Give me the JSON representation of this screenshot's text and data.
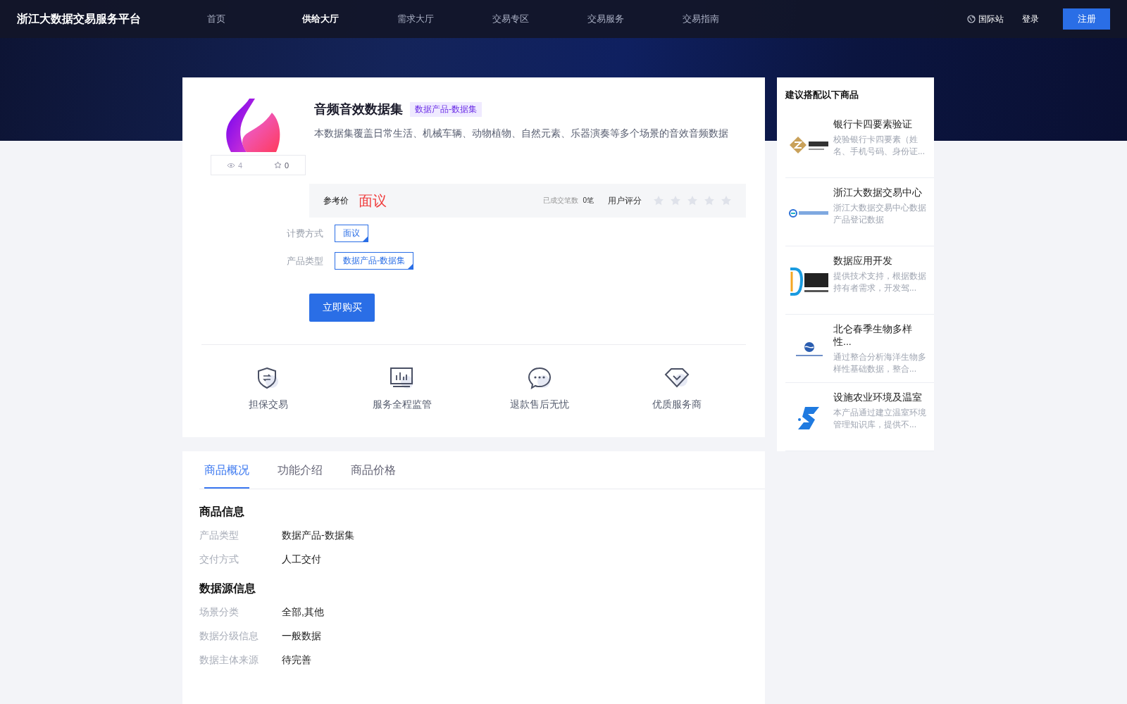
{
  "header": {
    "logo": "浙江大数据交易服务平台",
    "nav": [
      {
        "label": "首页",
        "selected": false
      },
      {
        "label": "供给大厅",
        "selected": true
      },
      {
        "label": "需求大厅",
        "selected": false
      },
      {
        "label": "交易专区",
        "selected": false
      },
      {
        "label": "交易服务",
        "selected": false
      },
      {
        "label": "交易指南",
        "selected": false
      }
    ],
    "language": "国际站",
    "login": "登录",
    "register": "注册"
  },
  "product": {
    "title": "音频音效数据集",
    "tag": "数据产品-数据集",
    "description": "本数据集覆盖日常生活、机械车辆、动物植物、自然元素、乐器演奏等多个场景的音效音频数据",
    "views": "4",
    "favorites": "0",
    "price_label": "参考价",
    "price": "面议",
    "deals_label": "已成交笔数",
    "deals": "0笔",
    "rating_label": "用户评分",
    "stars": 0,
    "attributes": [
      {
        "label": "计费方式",
        "value": "面议"
      },
      {
        "label": "产品类型",
        "value": "数据产品-数据集"
      }
    ],
    "buy": "立即购买",
    "guarantees": [
      {
        "kind": "shield",
        "label": "担保交易"
      },
      {
        "kind": "monitor",
        "label": "服务全程监管"
      },
      {
        "kind": "chat",
        "label": "退款售后无忧"
      },
      {
        "kind": "diamond",
        "label": "优质服务商"
      }
    ]
  },
  "recommend": {
    "title": "建议搭配以下商品",
    "items": [
      {
        "kind": "coin",
        "title": "银行卡四要素验证",
        "description": "校验银行卡四要素（姓名、手机号码、身份证..."
      },
      {
        "kind": "ring",
        "title": "浙江大数据交易中心",
        "description": "浙江大数据交易中心数据产品登记数据"
      },
      {
        "kind": "bracket",
        "title": "数据应用开发",
        "description": "提供技术支持，根据数据持有者需求，开发驾..."
      },
      {
        "kind": "wave",
        "title": "北仑春季生物多样性...",
        "description": "通过整合分析海洋生物多样性基础数据，整合..."
      },
      {
        "kind": "s",
        "title": "设施农业环境及温室",
        "description": "本产品通过建立温室环境管理知识库，提供不..."
      }
    ]
  },
  "tabs": [
    {
      "label": "商品概况",
      "selected": true
    },
    {
      "label": "功能介绍",
      "selected": false
    },
    {
      "label": "商品价格",
      "selected": false
    }
  ],
  "sections": [
    {
      "title": "商品信息",
      "rows": [
        {
          "label": "产品类型",
          "value": "数据产品-数据集"
        },
        {
          "label": "交付方式",
          "value": "人工交付"
        }
      ]
    },
    {
      "title": "数据源信息",
      "rows": [
        {
          "label": "场景分类",
          "value": "全部,其他"
        },
        {
          "label": "数据分级信息",
          "value": "一般数据"
        },
        {
          "label": "数据主体来源",
          "value": "待完善"
        }
      ]
    }
  ]
}
